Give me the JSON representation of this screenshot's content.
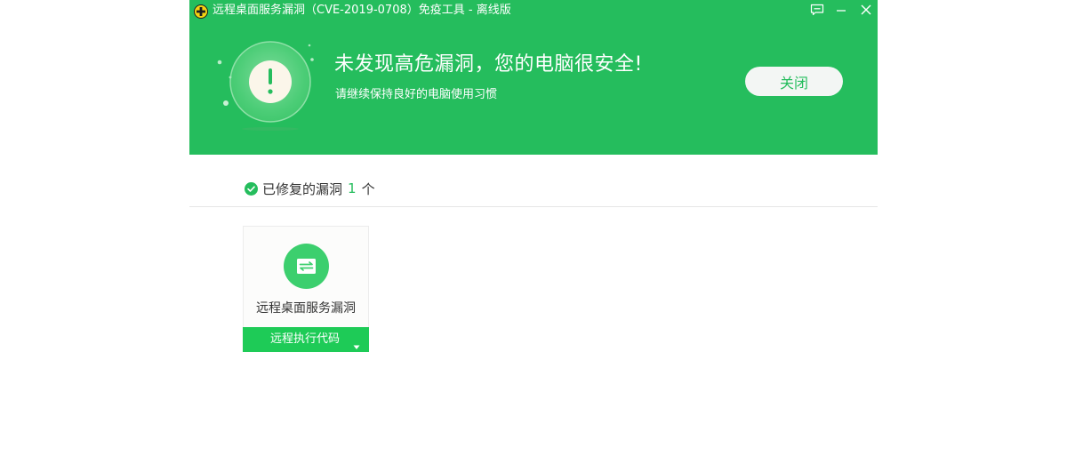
{
  "window": {
    "title": "远程桌面服务漏洞（CVE-2019-0708）免疫工具 - 离线版",
    "app_icon": "plus-shield-icon",
    "controls": [
      "feedback-icon",
      "minimize-icon",
      "close-icon"
    ]
  },
  "header": {
    "headline": "未发现高危漏洞，您的电脑很安全!",
    "subline": "请继续保持良好的电脑使用习惯",
    "close_label": "关闭",
    "status_icon": "exclamation-icon"
  },
  "summary": {
    "prefix": "已修复的漏洞",
    "count": "1",
    "suffix": "个",
    "icon": "check-circle-icon"
  },
  "vulnerabilities": [
    {
      "name": "远程桌面服务漏洞",
      "type": "远程执行代码",
      "icon": "remote-transfer-icon"
    }
  ],
  "colors": {
    "brand_green": "#25bd5d",
    "bar_green": "#1ecb57",
    "text": "#333333"
  }
}
